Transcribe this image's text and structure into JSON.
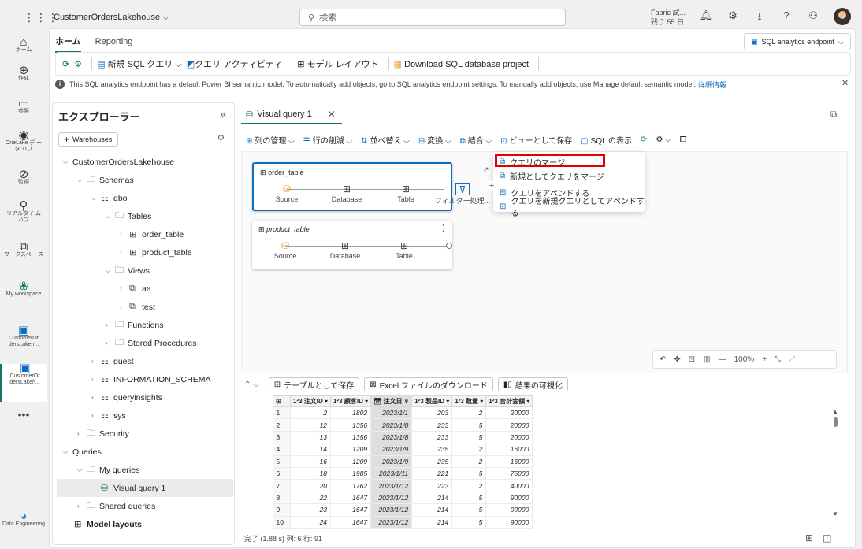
{
  "topbar": {
    "workspace_name": "CustomerOrdersLakehouse",
    "search_placeholder": "検索",
    "trial_line1": "Fabric 試...",
    "trial_line2": "残り 55 日"
  },
  "rail": {
    "items": [
      {
        "label": "ホーム",
        "icon": "home-icon"
      },
      {
        "label": "作成",
        "icon": "create-icon"
      },
      {
        "label": "参照",
        "icon": "browse-icon"
      },
      {
        "label": "OneLake デ ータ ハブ",
        "icon": "onelake-icon"
      },
      {
        "label": "監視",
        "icon": "monitor-icon"
      },
      {
        "label": "リアルタイ ム ハブ",
        "icon": "realtime-icon"
      },
      {
        "label": "ワークスペ ース",
        "icon": "workspaces-icon"
      },
      {
        "label": "My workspace",
        "icon": "my-workspace-icon"
      },
      {
        "label": "CustomerOr dersLakeh...",
        "icon": "lakehouse-icon"
      },
      {
        "label": "CustomerOr dersLakeh...",
        "icon": "sql-endpoint-icon"
      },
      {
        "label": "Data Engineering",
        "icon": "data-engineering-icon"
      }
    ]
  },
  "ribbon": {
    "tabs": [
      "ホーム",
      "Reporting"
    ],
    "endpoint_label": "SQL analytics endpoint",
    "buttons": {
      "new_sql_query": "新規 SQL クエリ",
      "query_activity": "クエリ アクティビティ",
      "model_layout": "モデル レイアウト",
      "download_project": "Download SQL database project"
    }
  },
  "infobar": {
    "text": "This SQL analytics endpoint has a default Power BI semantic model. To automatically add objects, go to SQL analytics endpoint settings. To manually add objects, use Manage default semantic model.",
    "link": "詳細情報"
  },
  "explorer": {
    "title": "エクスプローラー",
    "warehouses_button": "Warehouses",
    "tree": {
      "root": "CustomerOrdersLakehouse",
      "schemas": "Schemas",
      "dbo": "dbo",
      "tables": "Tables",
      "order_table": "order_table",
      "product_table": "product_table",
      "views": "Views",
      "aa": "aa",
      "test": "test",
      "functions": "Functions",
      "stored_procedures": "Stored Procedures",
      "guest": "guest",
      "information_schema": "INFORMATION_SCHEMA",
      "queryinsights": "queryinsights",
      "sys": "sys",
      "security": "Security",
      "queries": "Queries",
      "my_queries": "My queries",
      "visual_query_1": "Visual query 1",
      "shared_queries": "Shared queries",
      "model_layouts": "Model layouts"
    }
  },
  "query": {
    "tab_title": "Visual query 1",
    "toolbar": {
      "manage_columns": "列の管理",
      "reduce_rows": "行の削減",
      "sort": "並べ替え",
      "transform": "変換",
      "combine": "結合",
      "save_as_view": "ビューとして保存",
      "view_sql": "SQL の表示"
    },
    "cards": [
      {
        "title": "order_table",
        "steps": [
          "Source",
          "Database",
          "Table",
          "フィルター処理..."
        ]
      },
      {
        "title": "product_table",
        "steps": [
          "Source",
          "Database",
          "Table"
        ]
      }
    ],
    "context_menu": [
      "クエリのマージ",
      "新規としてクエリをマージ",
      "クエリをアペンドする",
      "クエリを新規クエリとしてアペンドする"
    ],
    "zoom": "100%"
  },
  "results": {
    "buttons": {
      "save_as_table": "テーブルとして保存",
      "download_excel": "Excel ファイルのダウンロード",
      "visualize": "結果の可視化"
    },
    "columns": [
      "注文ID",
      "顧客ID",
      "注文日",
      "製品ID",
      "数量",
      "合計金額"
    ],
    "column_types": [
      "1²3",
      "1²3",
      "date",
      "1²3",
      "1²3",
      "1²3"
    ],
    "rows": [
      [
        1,
        2,
        1802,
        "2023/1/1",
        203,
        2,
        20000
      ],
      [
        2,
        12,
        1356,
        "2023/1/8",
        233,
        5,
        20000
      ],
      [
        3,
        13,
        1356,
        "2023/1/8",
        233,
        5,
        20000
      ],
      [
        4,
        14,
        1209,
        "2023/1/9",
        235,
        2,
        16000
      ],
      [
        5,
        16,
        1209,
        "2023/1/9",
        235,
        2,
        16000
      ],
      [
        6,
        18,
        1985,
        "2023/1/11",
        221,
        5,
        75000
      ],
      [
        7,
        20,
        1762,
        "2023/1/12",
        223,
        2,
        40000
      ],
      [
        8,
        22,
        1647,
        "2023/1/12",
        214,
        5,
        90000
      ],
      [
        9,
        23,
        1647,
        "2023/1/12",
        214,
        5,
        90000
      ],
      [
        10,
        24,
        1647,
        "2023/1/12",
        214,
        5,
        90000
      ]
    ],
    "status": "完了 (1.88 s)  列: 6  行: 91"
  },
  "colors": {
    "accent": "#117865",
    "link": "#0f6cbd",
    "highlight": "#e00000"
  }
}
